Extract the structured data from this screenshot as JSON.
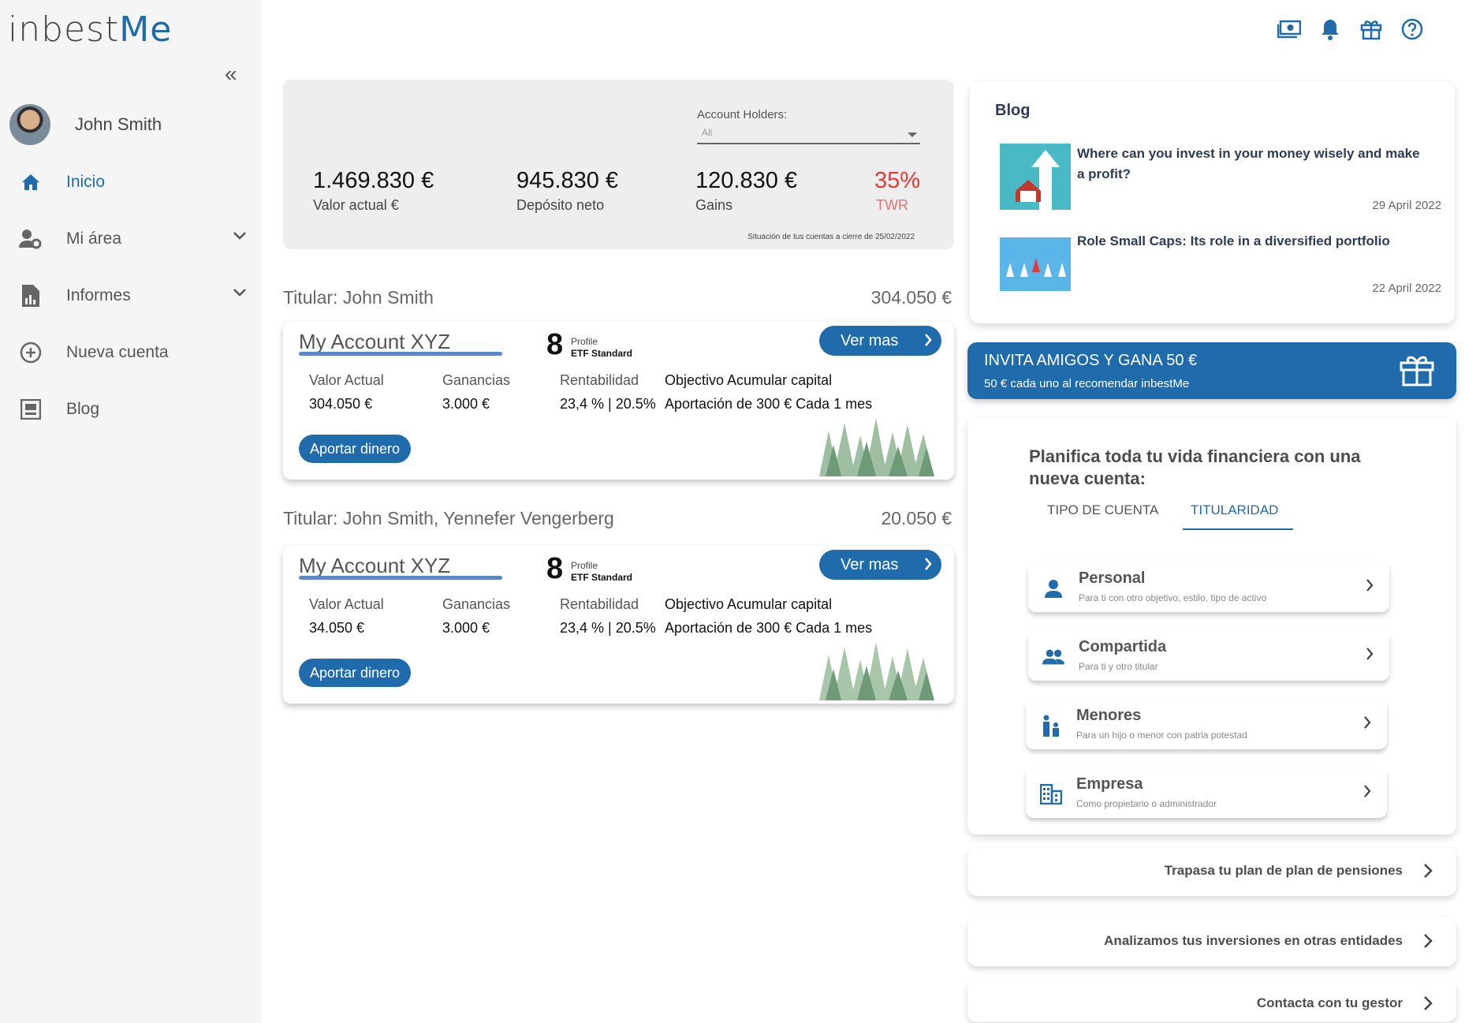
{
  "brand": {
    "logo_a": "inbest",
    "logo_b": "Me"
  },
  "sidebar": {
    "user_name": "John Smith",
    "items": [
      {
        "label": "Inicio",
        "icon": "home-icon",
        "active": true
      },
      {
        "label": "Mi área",
        "icon": "user-settings-icon"
      },
      {
        "label": "Informes",
        "icon": "report-icon"
      },
      {
        "label": "Nueva cuenta",
        "icon": "add-circle-icon"
      },
      {
        "label": "Blog",
        "icon": "blog-icon"
      }
    ]
  },
  "header_icons": [
    "money-icon",
    "bell-icon",
    "gift-icon",
    "help-icon"
  ],
  "summary": {
    "holders_label": "Account Holders:",
    "holders_value": "All",
    "valor_actual": "1.469.830 €",
    "valor_actual_label": "Valor actual €",
    "deposito": "945.830 €",
    "deposito_label": "Depósito neto",
    "gains": "120.830 €",
    "gains_label": "Gains",
    "twr": "35%",
    "twr_label": "TWR",
    "note": "Situación de tus cuentas a cierre de 25/02/2022"
  },
  "accounts": [
    {
      "titular": "Titular: John Smith",
      "total": "304.050 €",
      "name": "My Account XYZ",
      "profile_num": "8",
      "profile_label": "Profile",
      "profile_type": "ETF Standard",
      "ver_mas": "Ver mas",
      "valor_h": "Valor Actual",
      "valor": "304.050 €",
      "gan_h": "Ganancias",
      "gan": "3.000 €",
      "rent_h": "Rentabilidad",
      "rent": "23,4 % | 20.5%",
      "obj": "Objectivo Acumular capital",
      "aport": "Aportación de 300 € Cada 1 mes",
      "aportar_btn": "Aportar dinero"
    },
    {
      "titular": "Titular: John Smith, Yennefer Vengerberg",
      "total": "20.050 €",
      "name": "My Account XYZ",
      "profile_num": "8",
      "profile_label": "Profile",
      "profile_type": "ETF Standard",
      "ver_mas": "Ver mas",
      "valor_h": "Valor Actual",
      "valor": "34.050 €",
      "gan_h": "Ganancias",
      "gan": "3.000 €",
      "rent_h": "Rentabilidad",
      "rent": "23,4 % | 20.5%",
      "obj": "Objectivo Acumular capital",
      "aport": "Aportación de 300 € Cada 1 mes",
      "aportar_btn": "Aportar dinero"
    }
  ],
  "blog": {
    "title": "Blog",
    "posts": [
      {
        "title": "Where can you invest in your money wisely and make a profit?",
        "date": "29 April 2022"
      },
      {
        "title": "Role Small Caps: Its role in a diversified portfolio",
        "date": "22 April 2022"
      }
    ]
  },
  "invite": {
    "title": "INVITA AMIGOS Y GANA 50 €",
    "subtitle": "50 € cada uno al recomendar inbestMe"
  },
  "plan": {
    "title": "Planifica toda tu vida financiera con una nueva cuenta:",
    "tabs": [
      "TIPO DE CUENTA",
      "TITULARIDAD"
    ],
    "options": [
      {
        "name": "Personal",
        "desc": "Para ti con otro objetivo, estilo, tipo de activo",
        "icon": "person-icon"
      },
      {
        "name": "Compartida",
        "desc": "Para ti y otro titular",
        "icon": "people-icon"
      },
      {
        "name": "Menores",
        "desc": "Para un hijo o menor con patria potestad",
        "icon": "family-icon"
      },
      {
        "name": "Empresa",
        "desc": "Como propietario o administrador",
        "icon": "building-icon"
      }
    ]
  },
  "links": [
    "Trapasa tu plan de plan de pensiones",
    "Analizamos tus inversiones en otras entidades",
    "Contacta con tu gestor"
  ]
}
